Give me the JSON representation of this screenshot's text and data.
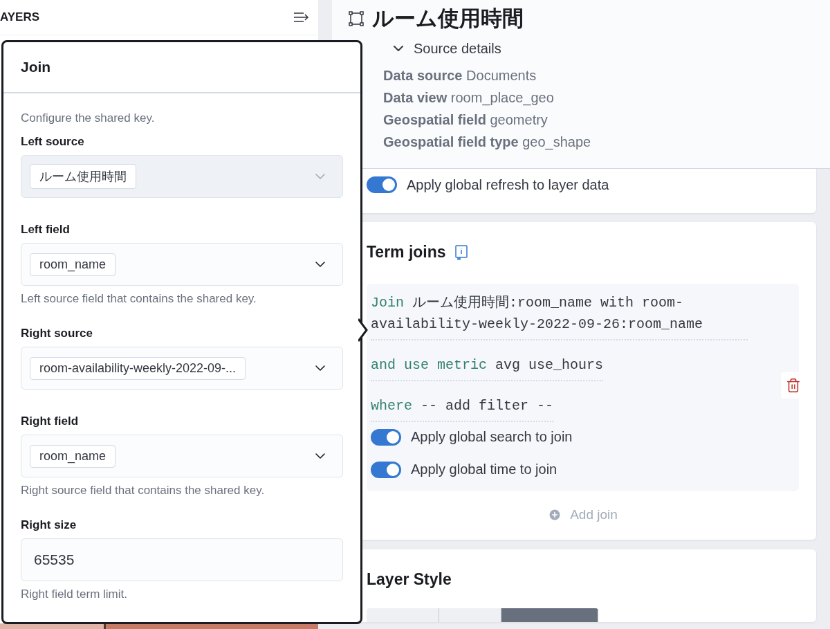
{
  "sidebar": {
    "title": "AYERS"
  },
  "popover": {
    "title": "Join",
    "description": "Configure the shared key.",
    "fields": [
      {
        "label": "Left source",
        "kind": "select",
        "value": "ルーム使用時間",
        "disabled": true
      },
      {
        "label": "Left field",
        "kind": "select",
        "value": "room_name",
        "disabled": false,
        "help": "Left source field that contains the shared key."
      },
      {
        "label": "Right source",
        "kind": "select",
        "value": "room-availability-weekly-2022-09-...",
        "disabled": false
      },
      {
        "label": "Right field",
        "kind": "select",
        "value": "room_name",
        "disabled": false,
        "help": "Right source field that contains the shared key."
      },
      {
        "label": "Right size",
        "kind": "number",
        "value": "65535",
        "help": "Right field term limit."
      }
    ]
  },
  "layer": {
    "title": "ルーム使用時間",
    "source_details": {
      "label": "Source details",
      "expanded": true,
      "rows": [
        {
          "key": "Data source",
          "value": "Documents"
        },
        {
          "key": "Data view",
          "value": "room_place_geo"
        },
        {
          "key": "Geospatial field",
          "value": "geometry"
        },
        {
          "key": "Geospatial field type",
          "value": "geo_shape"
        }
      ]
    }
  },
  "settings_card": {
    "toggles": [
      {
        "label": "Apply global refresh to layer data",
        "on": true
      }
    ]
  },
  "term_joins": {
    "title": "Term joins",
    "clauses": [
      {
        "keyword": "Join",
        "text": "ルーム使用時間:room_name with room-availability-weekly-2022-09-26:room_name"
      },
      {
        "keyword": "and use metric",
        "text": "avg use_hours"
      },
      {
        "keyword": "where",
        "text": "-- add filter --"
      }
    ],
    "toggles": [
      {
        "label": "Apply global search to join",
        "on": true
      },
      {
        "label": "Apply global time to join",
        "on": true
      }
    ],
    "add_button": {
      "label": "Add join",
      "disabled": true
    }
  },
  "layer_style": {
    "title": "Layer Style"
  }
}
